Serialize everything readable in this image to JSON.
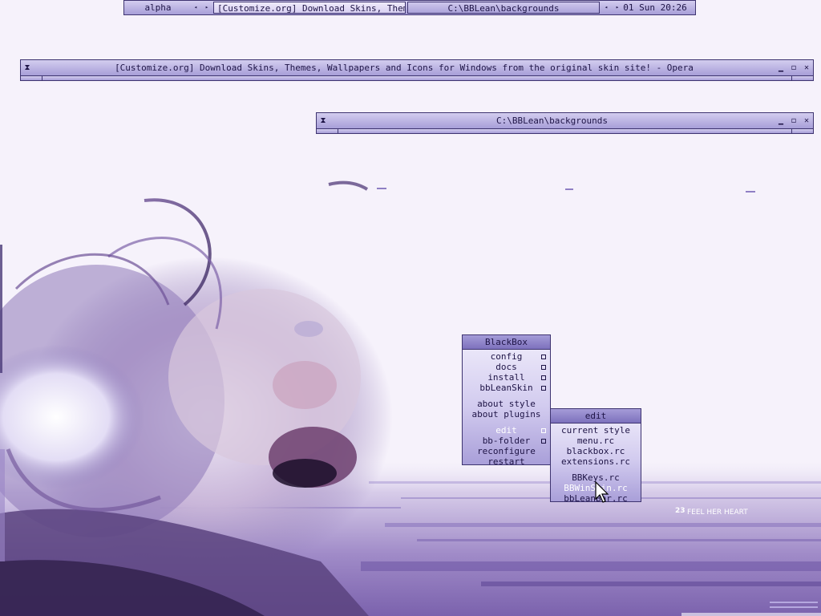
{
  "toolbar": {
    "workspace": "alpha",
    "prev_arrow": "◂",
    "next_arrow": "▸",
    "tasks": [
      {
        "label": "[Customize.org] Download Skins, Theme..."
      },
      {
        "label": "C:\\BBLean\\backgrounds"
      }
    ],
    "clock": "01 Sun 20:26"
  },
  "windows": {
    "opera": {
      "title": "[Customize.org] Download Skins, Themes, Wallpapers and Icons for Windows from the original skin site! - Opera"
    },
    "explorer": {
      "title": "C:\\BBLean\\backgrounds"
    },
    "buttons": {
      "sticky": "⧗",
      "minimize": "▁",
      "maximize": "◻",
      "close": "✕"
    }
  },
  "menus": {
    "blackbox": {
      "title": "BlackBox",
      "items": [
        {
          "label": "config"
        },
        {
          "label": "docs"
        },
        {
          "label": "install"
        },
        {
          "label": "bbLeanSkin"
        },
        {
          "label": "about style"
        },
        {
          "label": "about plugins"
        },
        {
          "label": "edit"
        },
        {
          "label": "bb-folder"
        },
        {
          "label": "reconfigure"
        },
        {
          "label": "restart"
        }
      ]
    },
    "edit": {
      "title": "edit",
      "items": [
        {
          "label": "current style"
        },
        {
          "label": "menu.rc"
        },
        {
          "label": "blackbox.rc"
        },
        {
          "label": "extensions.rc"
        },
        {
          "label": "BBKeys.rc"
        },
        {
          "label": "BBWinSkin.rc"
        },
        {
          "label": "bbLeanBar.rc"
        }
      ]
    }
  },
  "wallpaper": {
    "caption": "FEEL HER HEART",
    "caption_num": "23"
  },
  "colors": {
    "accent": "#8f84cc",
    "border": "#3e3470",
    "text": "#1e1446"
  }
}
